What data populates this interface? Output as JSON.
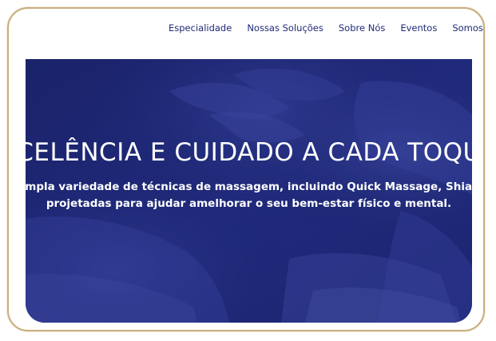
{
  "nav": {
    "items": [
      {
        "label": "Especialidade"
      },
      {
        "label": "Nossas Soluções"
      },
      {
        "label": "Sobre Nós"
      },
      {
        "label": "Eventos"
      },
      {
        "label": "Somos"
      }
    ]
  },
  "hero": {
    "title": "CELÊNCIA E CUIDADO A CADA TOQU",
    "subtitle_line1": "n ampla variedade de técnicas de massagem, incluindo Quick Massage, Shiatsu",
    "subtitle_line2": "projetadas para ajudar amelhorar o seu bem-estar físico e mental.",
    "overlay_color": "#1b2570",
    "title_color": "#ffffff"
  },
  "frame": {
    "border_color": "#c9ae7e"
  },
  "colors": {
    "nav_text": "#1f2a78"
  }
}
